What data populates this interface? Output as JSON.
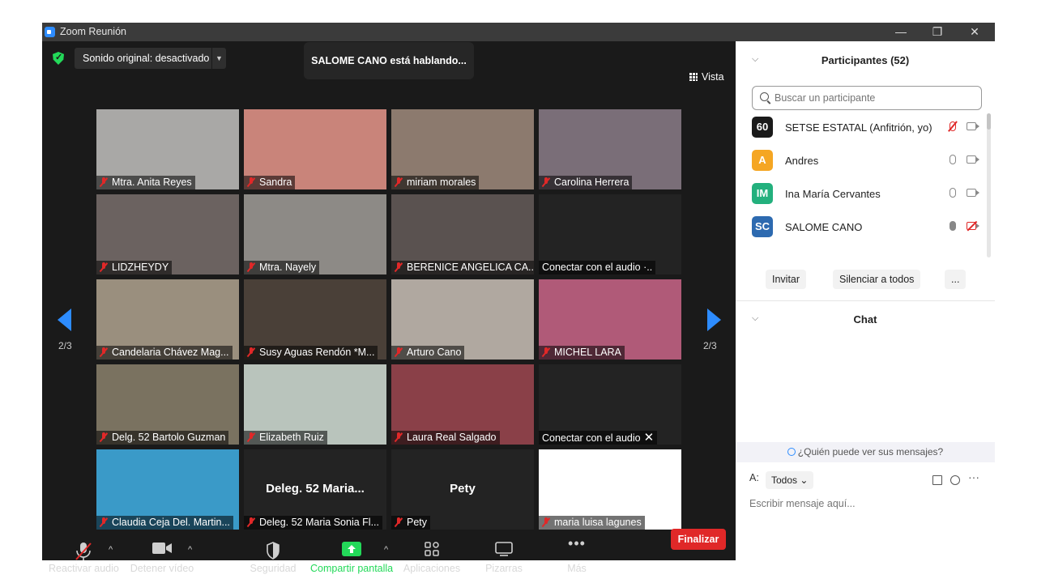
{
  "window": {
    "title": "Zoom Reunión"
  },
  "meeting": {
    "sound_label": "Sonido original: desactivado",
    "speaking_banner": "SALOME CANO está hablando...",
    "view_label": "Vista",
    "page_indicator": "2/3"
  },
  "tiles": [
    {
      "name": "Mtra. Anita Reyes",
      "muted": true,
      "color": "#a9a8a6"
    },
    {
      "name": "Sandra",
      "muted": true,
      "color": "#c9847a"
    },
    {
      "name": "miriam morales",
      "muted": true,
      "color": "#8c7a6e"
    },
    {
      "name": "Carolina Herrera",
      "muted": true,
      "color": "#7a6e78"
    },
    {
      "name": "LIDZHEYDY",
      "muted": true,
      "color": "#6b6260"
    },
    {
      "name": "Mtra. Nayely",
      "muted": true,
      "color": "#8d8a86"
    },
    {
      "name": "BERENICE ANGELICA CA...",
      "muted": true,
      "color": "#5a5250"
    },
    {
      "name": "Conectar con el audio ·..",
      "muted": false,
      "color": "#232323"
    },
    {
      "name": "Candelaria Chávez Mag...",
      "muted": true,
      "color": "#9a8f7e"
    },
    {
      "name": "Susy Aguas  Rendón *M...",
      "muted": true,
      "color": "#4a4038"
    },
    {
      "name": "Arturo Cano",
      "muted": true,
      "color": "#b0a8a0"
    },
    {
      "name": "MICHEL LARA",
      "muted": true,
      "color": "#b05a78"
    },
    {
      "name": "Delg. 52 Bartolo Guzman",
      "muted": true,
      "color": "#7a7260"
    },
    {
      "name": "Elizabeth Ruiz",
      "muted": true,
      "color": "#b9c4bc"
    },
    {
      "name": "Laura Real Salgado",
      "muted": true,
      "color": "#8a4048"
    },
    {
      "name": "Conectar con el audio",
      "muted": false,
      "color": "#232323"
    },
    {
      "name": "Claudia Ceja Del. Martin...",
      "muted": true,
      "color": "#3a9ac8"
    },
    {
      "name": "Deleg. 52 Maria Sonia Fl...",
      "muted": true,
      "color": "#232323",
      "center": "Deleg. 52  Maria..."
    },
    {
      "name": "Pety",
      "muted": true,
      "color": "#232323",
      "center": "Pety"
    },
    {
      "name": "maria luisa lagunes",
      "muted": true,
      "color": "#ffffff"
    }
  ],
  "toolbar": {
    "audio": "Reactivar audio",
    "video": "Detener vídeo",
    "security": "Seguridad",
    "share": "Compartir pantalla",
    "apps": "Aplicaciones",
    "whiteboards": "Pizarras",
    "more": "Más",
    "end": "Finalizar"
  },
  "panel": {
    "participants_title": "Participantes (52)",
    "search_placeholder": "Buscar un participante",
    "participants": [
      {
        "initials": "60",
        "name": "SETSE ESTATAL (Anfitrión, yo)",
        "avatar_color": "#1a1a1a",
        "mic": "off",
        "cam": "on"
      },
      {
        "initials": "A",
        "name": "Andres",
        "avatar_color": "#f5a623",
        "mic": "on",
        "cam": "on"
      },
      {
        "initials": "IM",
        "name": "Ina María Cervantes",
        "avatar_color": "#23b07d",
        "mic": "on",
        "cam": "on"
      },
      {
        "initials": "SC",
        "name": "SALOME CANO",
        "avatar_color": "#2d6ab0",
        "mic": "speaking",
        "cam": "off"
      }
    ],
    "invite": "Invitar",
    "mute_all": "Silenciar a todos",
    "more": "...",
    "chat_title": "Chat",
    "who_can_see": "¿Quién puede ver sus mensajes?",
    "to_label": "A:",
    "to_value": "Todos",
    "message_placeholder": "Escribir mensaje aquí..."
  }
}
